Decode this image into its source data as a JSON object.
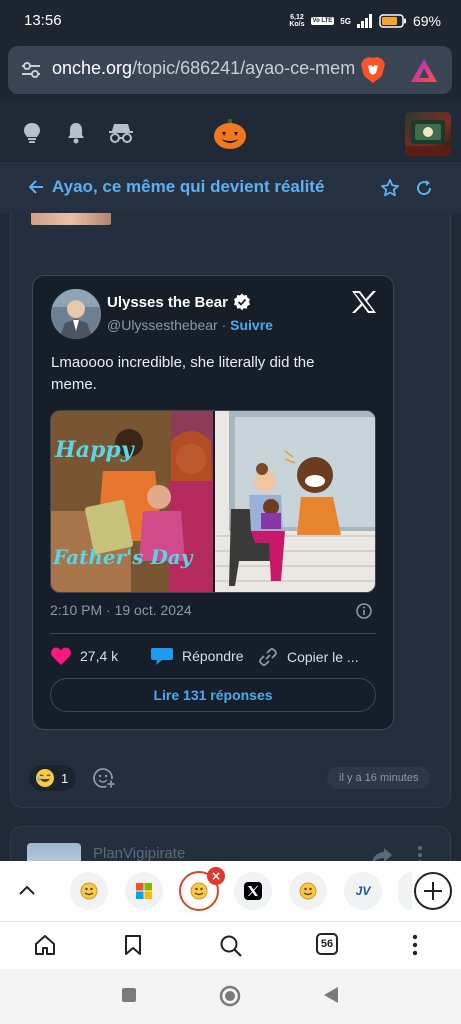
{
  "status_bar": {
    "time": "13:56",
    "net_speed_value": "6,12",
    "net_speed_unit": "Ko/s",
    "volte": "Vo LTE",
    "network": "5G",
    "battery": "69%"
  },
  "browser": {
    "url_domain": "onche.org",
    "url_path": "/topic/686241/ayao-ce-mem",
    "brave_icon": "brave-lion-icon",
    "rewards_icon": "brave-rewards-triangle-icon"
  },
  "forum_header": {
    "icons": [
      "lightbulb-icon",
      "bell-icon",
      "incognito-icon",
      "pumpkin-logo-icon",
      "user-avatar"
    ]
  },
  "topic": {
    "title": "Ayao, ce même qui devient réalité"
  },
  "tweet": {
    "author_name": "Ulysses the Bear",
    "handle": "@Ulyssesthebear",
    "separator": "·",
    "follow": "Suivre",
    "text": "Lmaoooo incredible, she literally did the meme.",
    "media_overlay_top": "Happy",
    "media_overlay_bottom": "Father's Day",
    "meta": "2:10 PM · 19 oct. 2024",
    "likes": "27,4 k",
    "reply": "Répondre",
    "copy": "Copier le ...",
    "read_replies": "Lire 131 réponses"
  },
  "reactions": {
    "emoji_count": "1",
    "time_ago": "il y a 16 minutes"
  },
  "next_post": {
    "author": "PlanVigipirate"
  },
  "tabstrip": {
    "tabs": [
      "onche-smiley-icon",
      "windows-logo-icon",
      "onche-smiley-icon-active",
      "x-logo-icon",
      "onche-smiley-icon",
      "jv-logo-icon"
    ],
    "jv_label": "JV"
  },
  "bottom_nav": {
    "tab_count": "56"
  },
  "colors": {
    "accent": "#5cb0f2",
    "background": "#202a36",
    "tweet_bg": "#161f29",
    "like_pink": "#f91880"
  }
}
